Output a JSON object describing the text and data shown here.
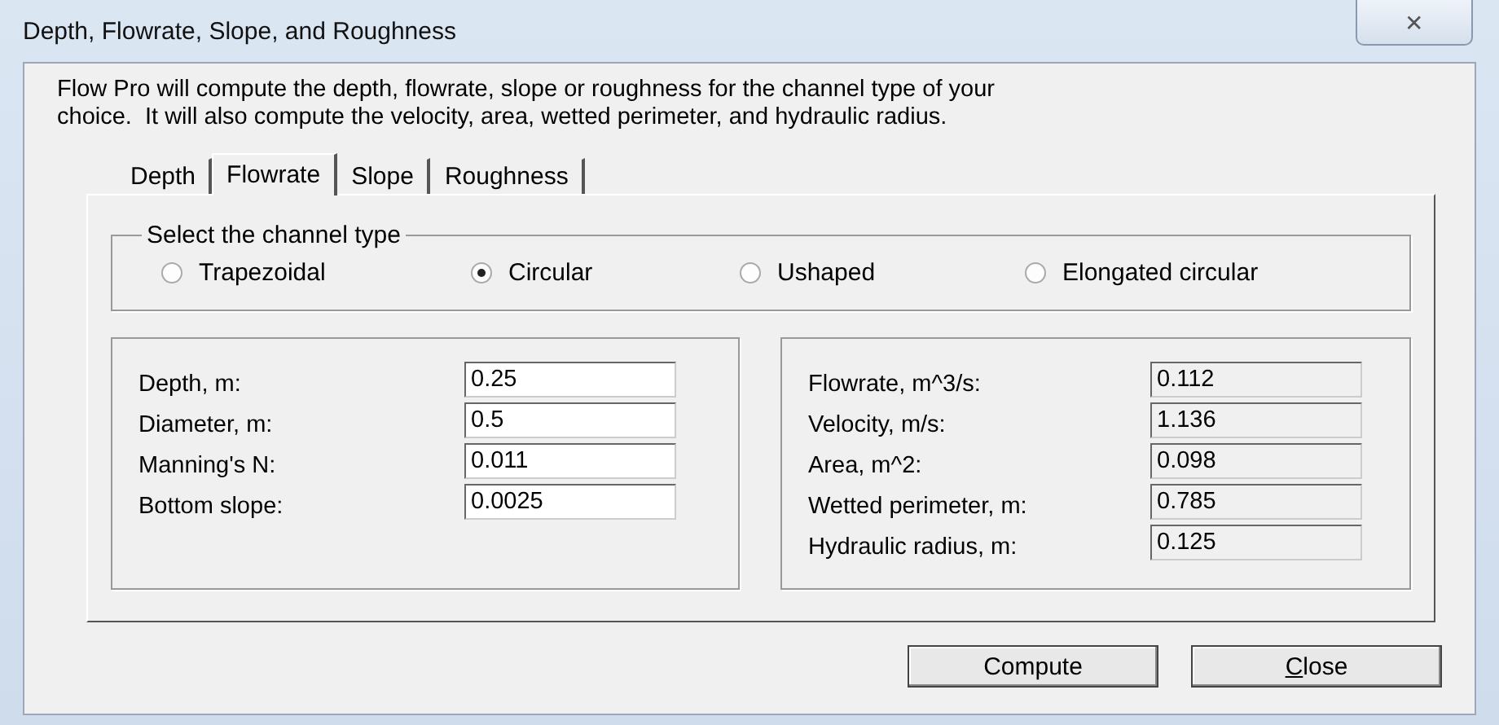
{
  "window": {
    "title": "Depth, Flowrate, Slope, and Roughness",
    "close": "✕"
  },
  "description_lines": [
    "Flow Pro will compute the depth, flowrate, slope or roughness for the channel type of your",
    "choice.  It will also compute the velocity, area, wetted perimeter, and hydraulic radius."
  ],
  "tabs": [
    {
      "label": "Depth",
      "selected": false
    },
    {
      "label": "Flowrate",
      "selected": true
    },
    {
      "label": "Slope",
      "selected": false
    },
    {
      "label": "Roughness",
      "selected": false
    }
  ],
  "channel_type": {
    "legend": "Select the channel type",
    "options": [
      {
        "label": "Trapezoidal",
        "selected": false
      },
      {
        "label": "Circular",
        "selected": true
      },
      {
        "label": "Ushaped",
        "selected": false
      },
      {
        "label": "Elongated circular",
        "selected": false
      }
    ]
  },
  "inputs": [
    {
      "label": "Depth, m:",
      "value": "0.25"
    },
    {
      "label": "Diameter, m:",
      "value": "0.5"
    },
    {
      "label": "Manning's N:",
      "value": "0.011"
    },
    {
      "label": "Bottom slope:",
      "value": "0.0025"
    }
  ],
  "outputs": [
    {
      "label": "Flowrate, m^3/s:",
      "value": "0.112"
    },
    {
      "label": "Velocity, m/s:",
      "value": "1.136"
    },
    {
      "label": "Area, m^2:",
      "value": "0.098"
    },
    {
      "label": "Wetted perimeter, m:",
      "value": "0.785"
    },
    {
      "label": "Hydraulic radius, m:",
      "value": "0.125"
    }
  ],
  "buttons": [
    {
      "label": "Compute",
      "underline_first": false
    },
    {
      "label": "Close",
      "underline_first": true
    }
  ]
}
